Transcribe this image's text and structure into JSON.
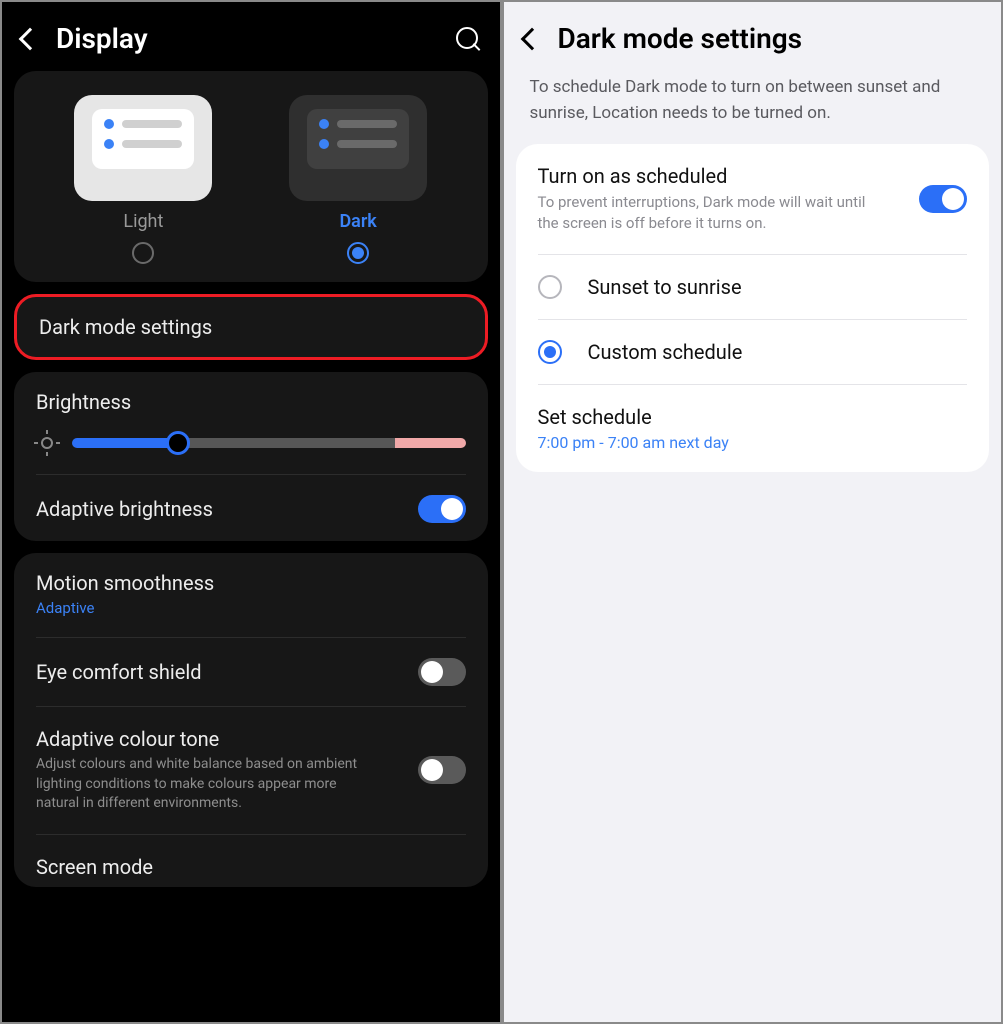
{
  "left": {
    "title": "Display",
    "theme": {
      "light_label": "Light",
      "dark_label": "Dark"
    },
    "dark_mode_settings": "Dark mode settings",
    "brightness_label": "Brightness",
    "adaptive_brightness": "Adaptive brightness",
    "motion_title": "Motion smoothness",
    "motion_value": "Adaptive",
    "eye_comfort": "Eye comfort shield",
    "adaptive_colour_title": "Adaptive colour tone",
    "adaptive_colour_desc": "Adjust colours and white balance based on ambient lighting conditions to make colours appear more natural in different environments.",
    "screen_mode": "Screen mode"
  },
  "right": {
    "title": "Dark mode settings",
    "info": "To schedule Dark mode to turn on between sunset and sunrise, Location needs to be turned on.",
    "schedule_title": "Turn on as scheduled",
    "schedule_desc": "To prevent interruptions, Dark mode will wait until the screen is off before it turns on.",
    "opt_sunset": "Sunset to sunrise",
    "opt_custom": "Custom schedule",
    "set_schedule": "Set schedule",
    "schedule_value": "7:00 pm - 7:00 am next day"
  }
}
